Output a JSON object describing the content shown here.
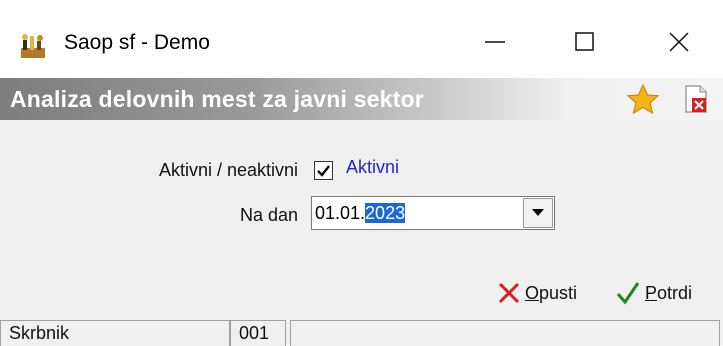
{
  "window": {
    "title": "Saop sf - Demo",
    "app_icon": "saop-app-icon",
    "controls": [
      "minimize-icon",
      "maximize-icon",
      "close-icon"
    ]
  },
  "header": {
    "title": "Analiza delovnih mest za javni sektor",
    "icons": [
      "star-icon",
      "pdf-close-icon"
    ]
  },
  "form": {
    "active_label": "Aktivni / neaktivni",
    "active_checked": true,
    "active_checkbox_label": "Aktivni",
    "date_label": "Na dan",
    "date_value_prefix": "01.01.",
    "date_value_selected": "2023"
  },
  "actions": {
    "cancel_underlined": "O",
    "cancel_rest": "pusti",
    "confirm_underlined": "P",
    "confirm_rest": "otrdi"
  },
  "status_bar": {
    "cell1": "Skrbnik",
    "cell2": "001",
    "cell3": ""
  },
  "colors": {
    "checkbox_label": "#2222dd",
    "selection": "#1e67d8",
    "cancel_icon": "#d61f1f",
    "confirm_icon": "#1a8a1a",
    "star": "#f6b316"
  }
}
